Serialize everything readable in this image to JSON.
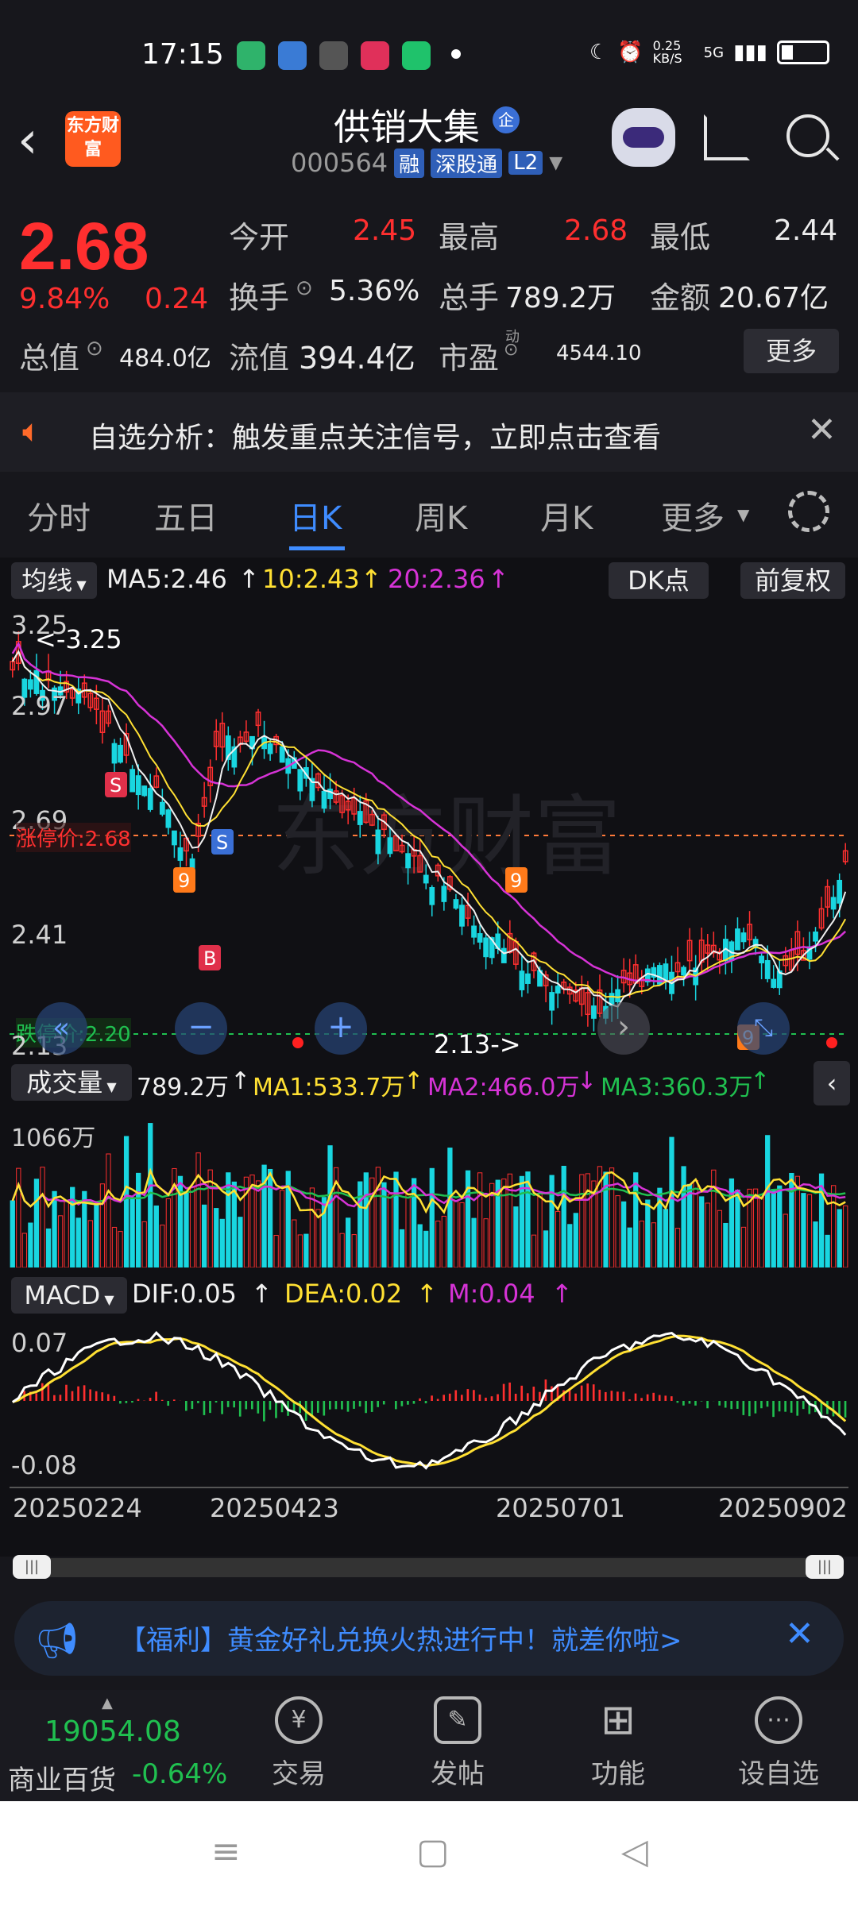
{
  "status_bar": {
    "time": "17:15",
    "net_speed": "0.25 KB/S",
    "network": "5G"
  },
  "header": {
    "stock_name": "供销大集",
    "badge": "企",
    "code": "000564",
    "tags": [
      "融",
      "深股通",
      "L2"
    ],
    "logo_text": "东方财富"
  },
  "quote": {
    "price": "2.68",
    "change_pct": "9.84%",
    "change": "0.24",
    "open_label": "今开",
    "open": "2.45",
    "high_label": "最高",
    "high": "2.68",
    "low_label": "最低",
    "low": "2.44",
    "turnover_label": "换手",
    "turnover": "5.36%",
    "volume_label": "总手",
    "volume": "789.2万",
    "amount_label": "金额",
    "amount": "20.67亿",
    "mktcap_label": "总值",
    "mktcap": "484.0亿",
    "float_label": "流值",
    "float_cap": "394.4亿",
    "pe_label": "市盈",
    "pe_sup": "动",
    "pe": "4544.10",
    "more_label": "更多"
  },
  "notice": {
    "text": "自选分析：触发重点关注信号，立即点击查看"
  },
  "tabs": [
    {
      "label": "分时"
    },
    {
      "label": "五日"
    },
    {
      "label": "日K"
    },
    {
      "label": "周K"
    },
    {
      "label": "月K"
    },
    {
      "label": "更多"
    }
  ],
  "kline": {
    "indicator_label": "均线",
    "ma5": "MA5:2.46",
    "ma10": "10:2.43",
    "ma20": "20:2.36",
    "dk_label": "DK点",
    "adjust_label": "前复权",
    "y_top": "3.25",
    "y_2": "2.97",
    "y_3": "2.69",
    "y_4": "2.41",
    "y_bottom": "2.13",
    "max_marker": "<-3.25",
    "min_marker": "2.13->",
    "limit_up": "涨停价:2.68",
    "limit_down": "跌停价:2.20",
    "watermark": "东方财富",
    "colors": {
      "up": "#ff2f2f",
      "down": "#19d6e0",
      "ma5": "#f0f0f0",
      "ma10": "#ffe033",
      "ma20": "#d633d6"
    }
  },
  "volume": {
    "indicator_label": "成交量",
    "value": "789.2万",
    "ma1": "MA1:533.7万",
    "ma2": "MA2:466.0万",
    "ma3": "MA3:360.3万",
    "y_top": "1066万"
  },
  "macd": {
    "indicator_label": "MACD",
    "dif": "DIF:0.05",
    "dea": "DEA:0.02",
    "m": "M:0.04",
    "y_top": "0.07",
    "y_bottom": "-0.08"
  },
  "dates": [
    "20250224",
    "20250423",
    "20250701",
    "20250902"
  ],
  "promo": {
    "text": "【福利】黄金好礼兑换火热进行中！就差你啦>"
  },
  "bottom": {
    "index_value": "19054.08",
    "index_name": "商业百货",
    "index_change": "-0.64%",
    "nav": [
      {
        "label": "交易",
        "icon": "yen-icon"
      },
      {
        "label": "发帖",
        "icon": "edit-icon"
      },
      {
        "label": "功能",
        "icon": "grid-icon"
      },
      {
        "label": "设自选",
        "icon": "more-circle-icon"
      }
    ]
  }
}
